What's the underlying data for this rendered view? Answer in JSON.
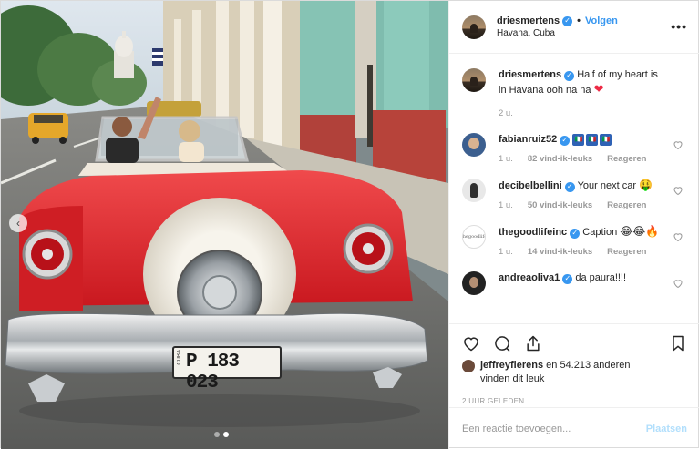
{
  "header": {
    "username": "driesmertens",
    "verified_glyph": "✓",
    "separator": "•",
    "follow_label": "Volgen",
    "location": "Havana, Cuba",
    "more_icon": "more-options-icon",
    "more_glyph": "•••"
  },
  "photo": {
    "license_plate": "P 183 023",
    "plate_country": "CUBA",
    "carousel_prev": "‹",
    "slide_count": 2,
    "active_slide": 2
  },
  "comments": [
    {
      "username": "driesmertens",
      "text": "Half of my heart is in Havana ooh na na",
      "emoji": "❤",
      "time": "2 u.",
      "likes": "",
      "reply": ""
    },
    {
      "username": "fabianruiz52",
      "text": "",
      "emoji": "",
      "time": "1 u.",
      "likes": "82 vind-ik-leuks",
      "reply": "Reageren"
    },
    {
      "username": "decibelbellini",
      "text": "Your next car",
      "emoji": "🤑",
      "time": "1 u.",
      "likes": "50 vind-ik-leuks",
      "reply": "Reageren"
    },
    {
      "username": "thegoodlifeinc",
      "text": "Caption",
      "emoji": "😂😂🔥",
      "time": "1 u.",
      "likes": "14 vind-ik-leuks",
      "reply": "Reageren"
    },
    {
      "username": "andreaoliva1",
      "text": "da paura!!!!",
      "emoji": "",
      "time": "",
      "likes": "",
      "reply": ""
    }
  ],
  "fabian_flags": [
    "🇮🇹",
    "🇮🇹",
    "🇮🇹"
  ],
  "goodlife_avatar_text": "thegoodlife",
  "actions": {
    "like_icon": "heart-icon",
    "comment_icon": "comment-icon",
    "share_icon": "share-icon",
    "save_icon": "bookmark-icon"
  },
  "likes": {
    "user": "jeffreyfierens",
    "rest": " en 54.213 anderen",
    "line2": "vinden dit leuk"
  },
  "timestamp": "2 UUR GELEDEN",
  "add_comment": {
    "placeholder": "Een reactie toevoegen...",
    "post_label": "Plaatsen"
  },
  "colors": {
    "accent": "#3897f0",
    "verified": "#3897f0",
    "heart": "#ed2a45",
    "post_disabled": "#b2dffc",
    "car_red": "#e0262b"
  }
}
